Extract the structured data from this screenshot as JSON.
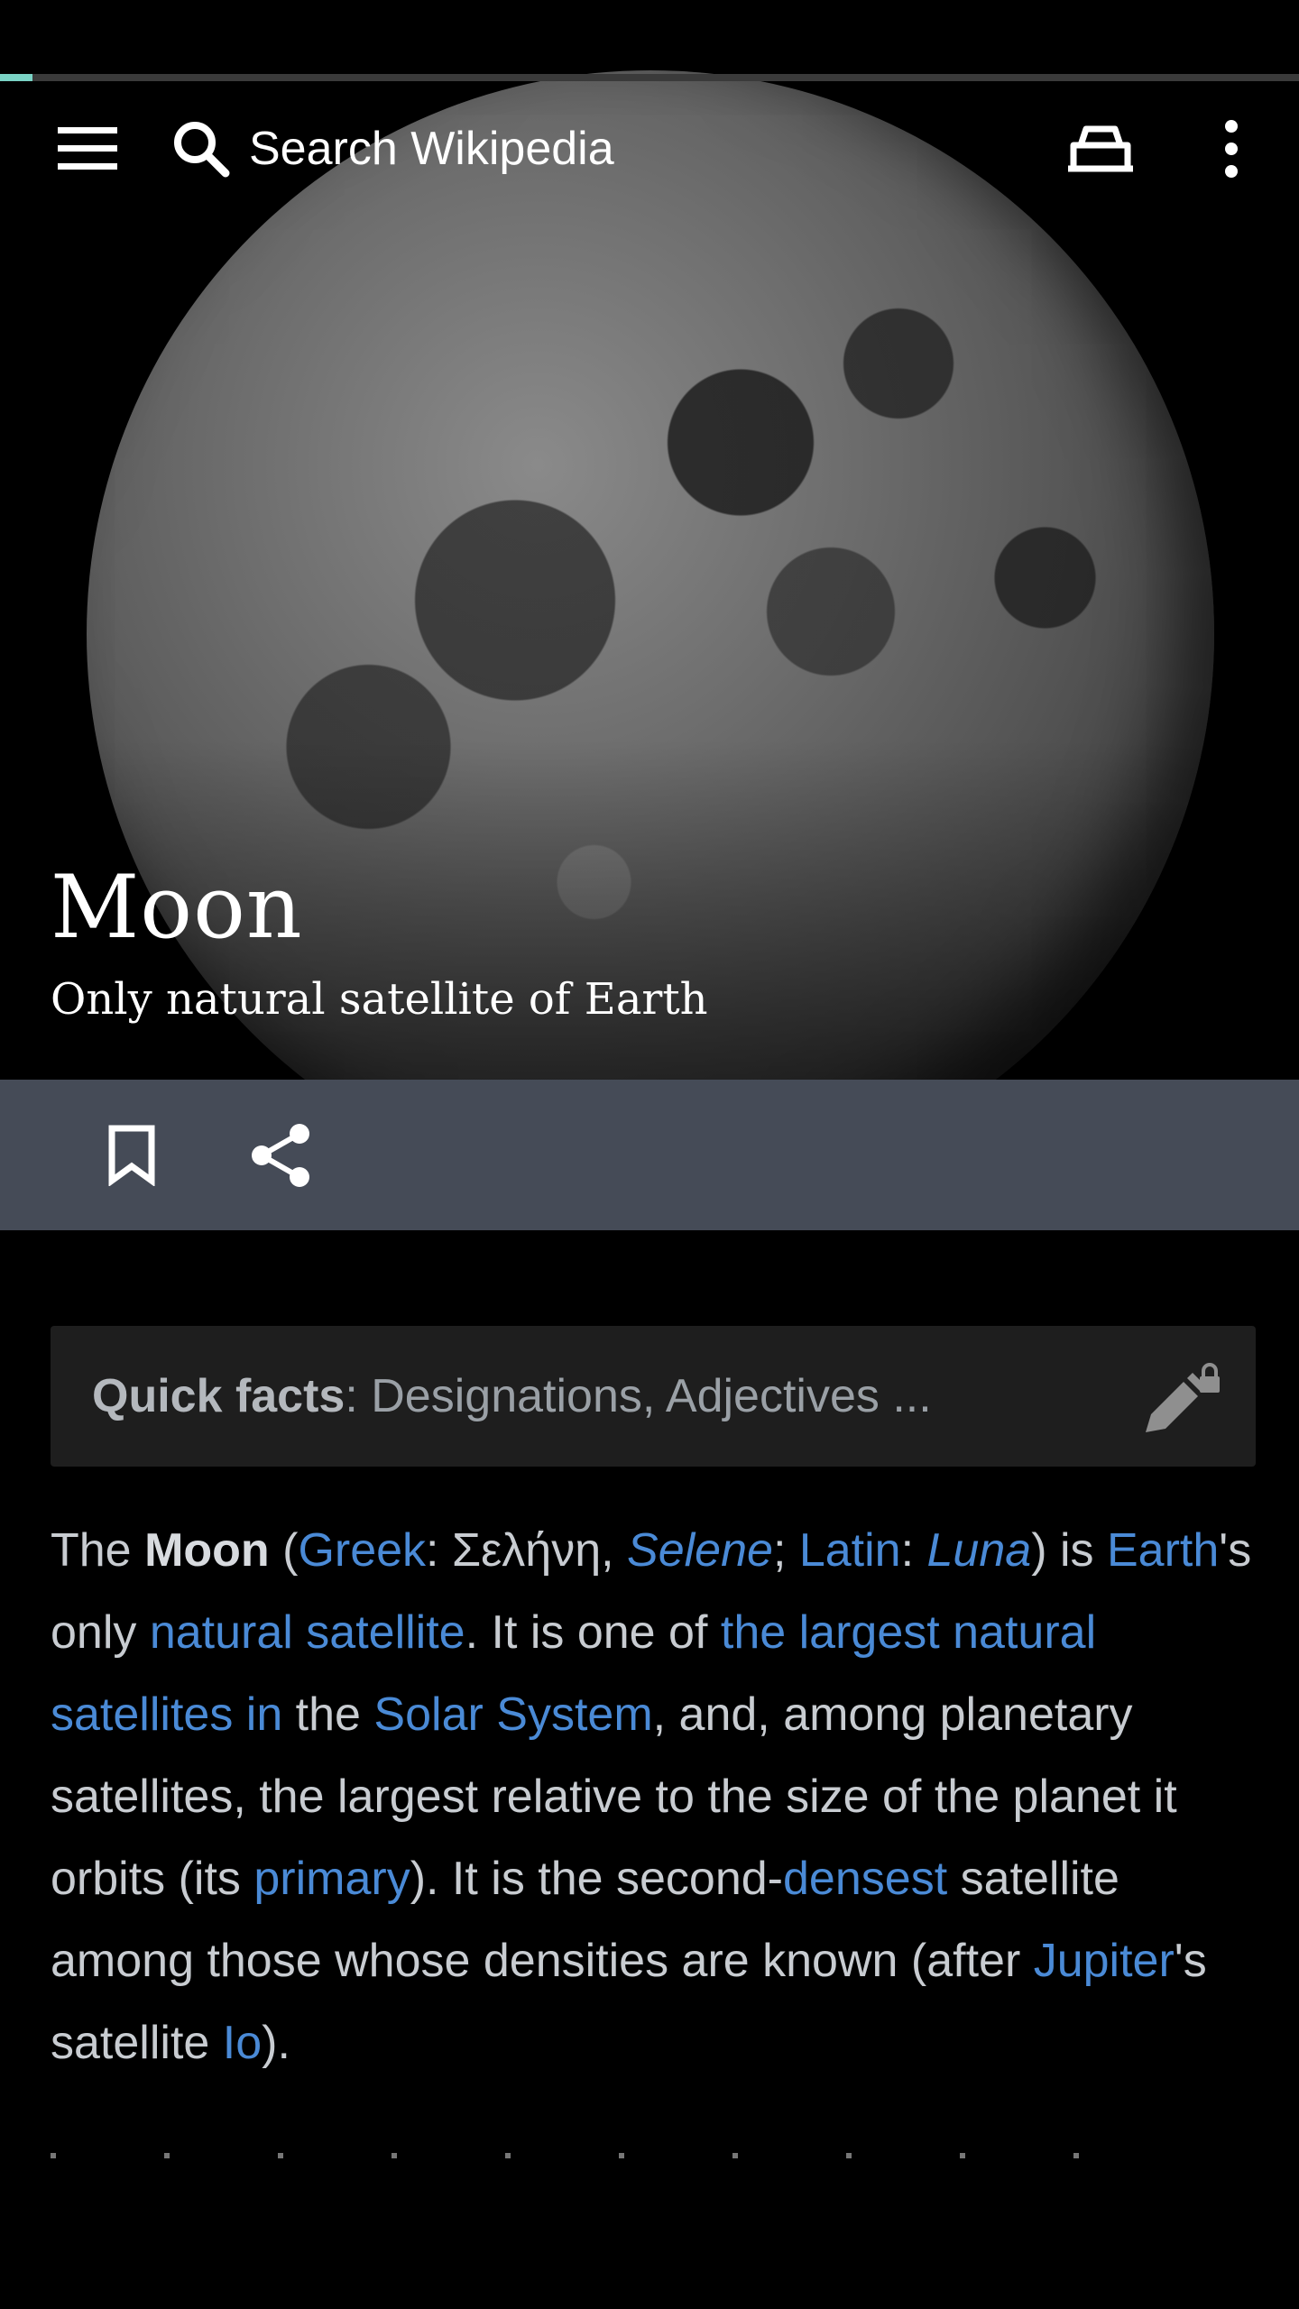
{
  "toolbar": {
    "search_placeholder": "Search Wikipedia",
    "menu_icon": "hamburger-menu-icon",
    "search_icon": "search-icon",
    "reading_icon": "reading-lists-icon",
    "more_icon": "more-vertical-icon"
  },
  "page_load_progress": 0.025,
  "article": {
    "title": "Moon",
    "description": "Only natural satellite of Earth",
    "actions": {
      "save_icon": "bookmark-icon",
      "share_icon": "share-icon"
    },
    "quick_facts": {
      "label": "Quick facts",
      "separator": ": ",
      "summary": "Designations, Adjectives ...",
      "edit_icon": "edit-locked-icon"
    },
    "paragraph": {
      "t1": "The ",
      "bold_moon": "Moon",
      "t2": " (",
      "link_greek": "Greek",
      "t3": ": Σελήνη, ",
      "link_selene": "Selene",
      "t4": "; ",
      "link_latin": "Latin",
      "t5": ": ",
      "link_luna": "Luna",
      "t6": ") is ",
      "link_earth": "Earth",
      "t7": "'s only ",
      "link_natural_satellite": "natural satellite",
      "t8": ". It is one of ",
      "link_largest": "the largest natural satellites in",
      "t9": " the ",
      "link_solar_system": "Solar System",
      "t10": ", and, among planetary satellites, the largest relative to the size of the planet it orbits (its ",
      "link_primary": "primary",
      "t11": "). It is the second-",
      "link_densest": "densest",
      "t12": " satellite among those whose densities are known (after ",
      "link_jupiter": "Jupiter",
      "t13": "'s satellite ",
      "link_io": "Io",
      "t14": ")."
    }
  },
  "colors": {
    "background": "#000000",
    "action_bar": "#454b57",
    "quick_facts_bg": "#1e1e1e",
    "link": "#4a8ad6",
    "text": "#c8ccd1",
    "progress": "#7ad3c5"
  }
}
